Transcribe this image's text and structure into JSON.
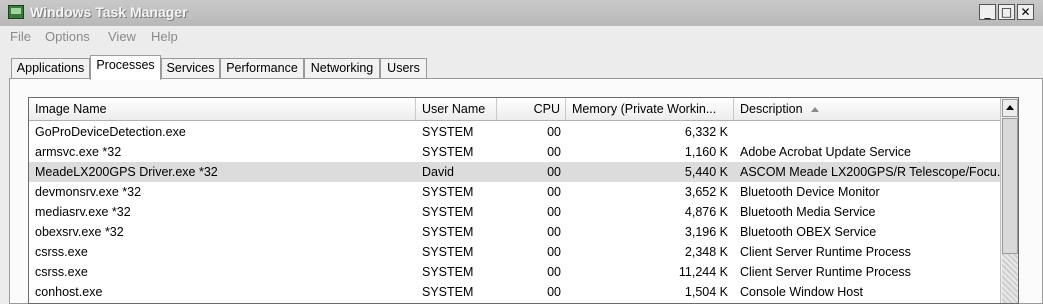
{
  "window": {
    "title": "Windows Task Manager",
    "controls": {
      "minimize": "_",
      "maximize": "□",
      "close": "✕"
    }
  },
  "menu": [
    "File",
    "Options",
    "View",
    "Help"
  ],
  "tabs": [
    {
      "label": "Applications",
      "active": false
    },
    {
      "label": "Processes",
      "active": true
    },
    {
      "label": "Services",
      "active": false
    },
    {
      "label": "Performance",
      "active": false
    },
    {
      "label": "Networking",
      "active": false
    },
    {
      "label": "Users",
      "active": false
    }
  ],
  "table": {
    "columns": [
      "Image Name",
      "User Name",
      "CPU",
      "Memory (Private Workin...",
      "Description"
    ],
    "sort_column": "Description",
    "sort_direction": "ascending",
    "rows": [
      {
        "image": "GoProDeviceDetection.exe",
        "user": "SYSTEM",
        "cpu": "00",
        "memory": "6,332 K",
        "description": "",
        "selected": false
      },
      {
        "image": "armsvc.exe *32",
        "user": "SYSTEM",
        "cpu": "00",
        "memory": "1,160 K",
        "description": "Adobe Acrobat Update Service",
        "selected": false
      },
      {
        "image": "MeadeLX200GPS Driver.exe *32",
        "user": "David",
        "cpu": "00",
        "memory": "5,440 K",
        "description": "ASCOM Meade LX200GPS/R Telescope/Focu...",
        "selected": true
      },
      {
        "image": "devmonsrv.exe *32",
        "user": "SYSTEM",
        "cpu": "00",
        "memory": "3,652 K",
        "description": "Bluetooth Device Monitor",
        "selected": false
      },
      {
        "image": "mediasrv.exe *32",
        "user": "SYSTEM",
        "cpu": "00",
        "memory": "4,876 K",
        "description": "Bluetooth Media Service",
        "selected": false
      },
      {
        "image": "obexsrv.exe *32",
        "user": "SYSTEM",
        "cpu": "00",
        "memory": "3,196 K",
        "description": "Bluetooth OBEX Service",
        "selected": false
      },
      {
        "image": "csrss.exe",
        "user": "SYSTEM",
        "cpu": "00",
        "memory": "2,348 K",
        "description": "Client Server Runtime Process",
        "selected": false
      },
      {
        "image": "csrss.exe",
        "user": "SYSTEM",
        "cpu": "00",
        "memory": "11,244 K",
        "description": "Client Server Runtime Process",
        "selected": false
      },
      {
        "image": "conhost.exe",
        "user": "SYSTEM",
        "cpu": "00",
        "memory": "1,504 K",
        "description": "Console Window Host",
        "selected": false
      }
    ]
  },
  "icons": {
    "app": "task-manager-icon",
    "sort": "sort-ascending-icon",
    "scroll_up": "scroll-up-arrow-icon"
  },
  "colors": {
    "title_bar": "#c0c0c0",
    "selected_row": "#dcdcdc",
    "disabled_menu_text": "#8a8a8a"
  }
}
